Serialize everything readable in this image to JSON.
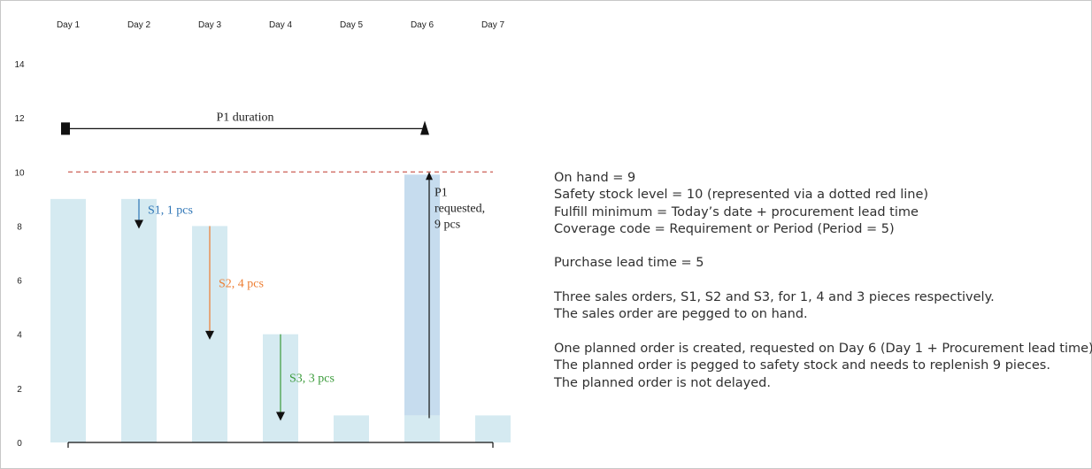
{
  "chart_data": {
    "type": "bar",
    "categories": [
      "Day 1",
      "Day 2",
      "Day 3",
      "Day 4",
      "Day 5",
      "Day 6",
      "Day 7"
    ],
    "values": [
      9,
      9,
      8,
      4,
      1,
      1,
      1
    ],
    "stacked_bar": {
      "category": "Day 6",
      "base": 1,
      "top": 9.9,
      "color": "#c6dcee"
    },
    "yticks": [
      0,
      2,
      4,
      6,
      8,
      10,
      12,
      14
    ],
    "ylim": [
      0,
      14
    ],
    "safety_stock_level": 10,
    "title": "",
    "xlabel": "",
    "ylabel": "",
    "grid": false,
    "colors": {
      "bar": "#d5eaf1",
      "safety_line": "#c0392b",
      "s1": "#2e75b6",
      "s2": "#ed7d31",
      "s3": "#3a9b3a",
      "black": "#111111"
    },
    "duration": {
      "label": "P1 duration",
      "from": "Day 1",
      "to": "Day 6",
      "y": 11.6
    },
    "sales_orders": [
      {
        "label": "S1, 1 pcs",
        "category": "Day 2",
        "from": 9,
        "to": 7.9,
        "color_key": "s1"
      },
      {
        "label": "S2, 4 pcs",
        "category": "Day 3",
        "from": 8,
        "to": 3.8,
        "color_key": "s2"
      },
      {
        "label": "S3, 3 pcs",
        "category": "Day 4",
        "from": 4,
        "to": 0.8,
        "color_key": "s3"
      }
    ],
    "planned_order": {
      "label_lines": [
        "P1",
        "requested,",
        "9 pcs"
      ],
      "category": "Day 6",
      "from": 0.9,
      "to": 10
    }
  },
  "notes": [
    "On hand = 9",
    "Safety stock level = 10 (represented via a dotted red line)",
    "Fulfill minimum = Today’s date + procurement lead time",
    "Coverage code = Requirement or Period (Period = 5)",
    "",
    "Purchase lead time = 5",
    "",
    "Three sales orders, S1, S2 and S3, for 1, 4 and 3 pieces respectively.",
    "The sales order are pegged to on hand.",
    "",
    "One planned order is created, requested on Day 6 (Day 1 + Procurement lead time).",
    "The planned order is pegged to safety stock and needs to replenish 9 pieces.",
    "The planned order is not delayed."
  ]
}
